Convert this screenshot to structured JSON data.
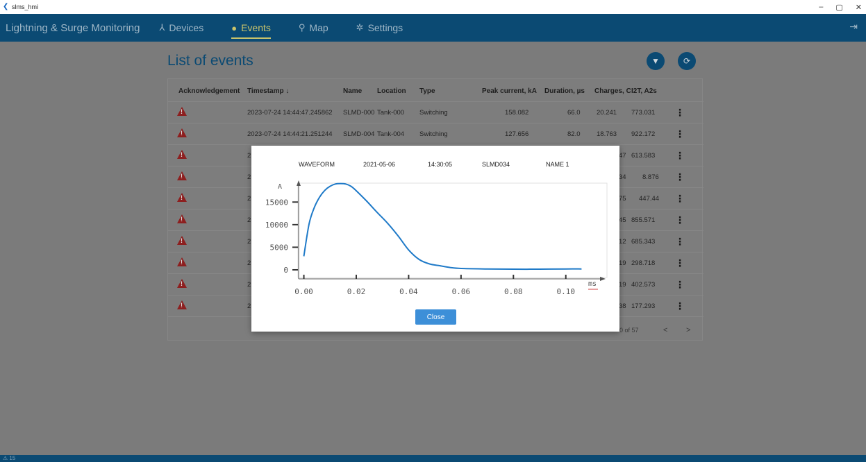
{
  "window": {
    "title": "slms_hmi",
    "minimize": "–",
    "maximize": "▢",
    "close": "✕"
  },
  "nav": {
    "brand": "Lightning & Surge Monitoring",
    "items": [
      {
        "label": "Devices",
        "icon": "devices-icon",
        "glyph": "⅄"
      },
      {
        "label": "Events",
        "icon": "info-icon",
        "glyph": "●"
      },
      {
        "label": "Map",
        "icon": "map-pin-icon",
        "glyph": "⚲"
      },
      {
        "label": "Settings",
        "icon": "gear-icon",
        "glyph": "✲"
      }
    ],
    "active": "Events",
    "colors": {
      "bar": "#0b4a73",
      "active": "#c9c36b",
      "inactive": "#9fb7c7"
    }
  },
  "page": {
    "title": "List of events",
    "filter_icon": "filter-icon",
    "refresh_icon": "refresh-icon"
  },
  "table": {
    "columns": [
      "Acknowledgement",
      "Timestamp ↓",
      "Name",
      "Location",
      "Type",
      "Peak current, kA",
      "Duration, µs",
      "Charges, C",
      "I2T, A2s"
    ],
    "rows": [
      {
        "timestamp": "2023-07-24 14:44:47.245862",
        "name": "SLMD-000",
        "location": "Tank-000",
        "type": "Switching",
        "peak": "158.082",
        "duration": "66.0",
        "charges": "20.241",
        "i2t": "773.031"
      },
      {
        "timestamp": "2023-07-24 14:44:21.251244",
        "name": "SLMD-004",
        "location": "Tank-004",
        "type": "Switching",
        "peak": "127.656",
        "duration": "82.0",
        "charges": "18.763",
        "i2t": "922.172"
      },
      {
        "timestamp": "2",
        "charges": "47",
        "i2t": "613.583"
      },
      {
        "timestamp": "2",
        "charges": "34",
        "i2t": "8.876"
      },
      {
        "timestamp": "2",
        "charges": "75",
        "i2t": "447.44"
      },
      {
        "timestamp": "2",
        "charges": "45",
        "i2t": "855.571"
      },
      {
        "timestamp": "2",
        "charges": "12",
        "i2t": "685.343"
      },
      {
        "timestamp": "2",
        "charges": "19",
        "i2t": "298.718"
      },
      {
        "timestamp": "2",
        "charges": "19",
        "i2t": "402.573"
      },
      {
        "timestamp": "2",
        "charges": "38",
        "i2t": "177.293"
      }
    ],
    "pagination": {
      "range": "0 of 57",
      "prev": "<",
      "next": ">"
    }
  },
  "modal": {
    "header": [
      "WAVEFORM",
      "2021-05-06",
      "14:30:05",
      "SLMD034",
      "NAME 1"
    ],
    "close_label": "Close"
  },
  "chart_data": {
    "type": "line",
    "xlabel": "ms",
    "ylabel": "A",
    "xlim": [
      -0.002,
      0.112
    ],
    "ylim": [
      -2000,
      19500
    ],
    "x_ticks": [
      0.0,
      0.02,
      0.04,
      0.06,
      0.08,
      0.1
    ],
    "x_tick_labels": [
      "0.00",
      "0.02",
      "0.04",
      "0.06",
      "0.08",
      "0.10"
    ],
    "y_ticks": [
      0,
      5000,
      10000,
      15000
    ],
    "y_tick_labels": [
      "0",
      "5000",
      "10000",
      "15000"
    ],
    "series": [
      {
        "color": "#1f7ac8",
        "x": [
          0.0,
          0.002,
          0.004,
          0.006,
          0.008,
          0.01,
          0.012,
          0.014,
          0.016,
          0.018,
          0.02,
          0.024,
          0.028,
          0.032,
          0.036,
          0.04,
          0.044,
          0.048,
          0.052,
          0.056,
          0.06,
          0.07,
          0.08,
          0.09,
          0.1,
          0.106
        ],
        "y": [
          3000,
          10200,
          13800,
          16100,
          17600,
          18500,
          19000,
          19100,
          19000,
          18500,
          17500,
          15200,
          12700,
          10300,
          7500,
          4400,
          2300,
          1300,
          900,
          500,
          300,
          200,
          150,
          150,
          200,
          200
        ]
      }
    ],
    "grid": false
  },
  "statusbar": {
    "text": "15"
  }
}
